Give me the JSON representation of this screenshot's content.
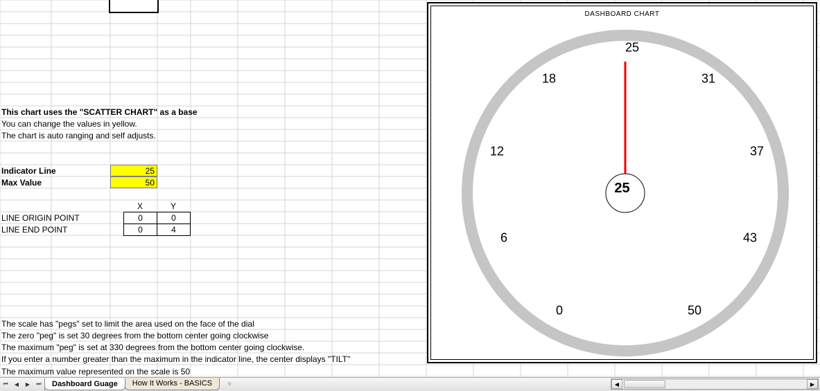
{
  "instructions": {
    "heading": "This chart uses the \"SCATTER CHART\" as a base",
    "line1": "You can change the values in yellow.",
    "line2": "The chart is auto ranging and self adjusts."
  },
  "params": {
    "indicator_label": "Indicator Line",
    "indicator_value": "25",
    "max_label": "Max Value",
    "max_value": "50"
  },
  "xy_table": {
    "x_header": "X",
    "y_header": "Y",
    "origin_label": "LINE ORIGIN POINT",
    "end_label": "LINE END POINT",
    "origin_x": "0",
    "origin_y": "0",
    "end_x": "0",
    "end_y": "4"
  },
  "notes": {
    "scale1": "The scale has \"pegs\" set to limit the area used on the face of the dial",
    "scale2": "The zero \"peg\" is set 30 degrees from the bottom center going clockwise",
    "scale3": "The maximum \"peg\" is set at 330 degrees from the bottom center going clockwise.",
    "scale4": "If you enter a number greater than the maximum in the indicator line, the center displays \"TILT\"",
    "scale5": "The maximum value represented on the scale is 50"
  },
  "chart": {
    "title": "DASHBOARD CHART",
    "center_value": "25",
    "labels": [
      "0",
      "6",
      "12",
      "18",
      "25",
      "31",
      "37",
      "43",
      "50"
    ]
  },
  "tabs": {
    "active": "Dashboard Guage",
    "other": "How It Works - BASICS"
  },
  "chart_data": {
    "type": "scatter",
    "title": "DASHBOARD CHART",
    "gauge_min": 0,
    "gauge_max": 50,
    "peg_start_deg_from_bottom": 30,
    "peg_end_deg_from_bottom": 330,
    "indicator_value": 25,
    "tick_labels": [
      0,
      6,
      12,
      18,
      25,
      31,
      37,
      43,
      50
    ],
    "series": [
      {
        "name": "LINE ORIGIN POINT",
        "x": 0,
        "y": 0
      },
      {
        "name": "LINE END POINT",
        "x": 0,
        "y": 4
      }
    ]
  }
}
